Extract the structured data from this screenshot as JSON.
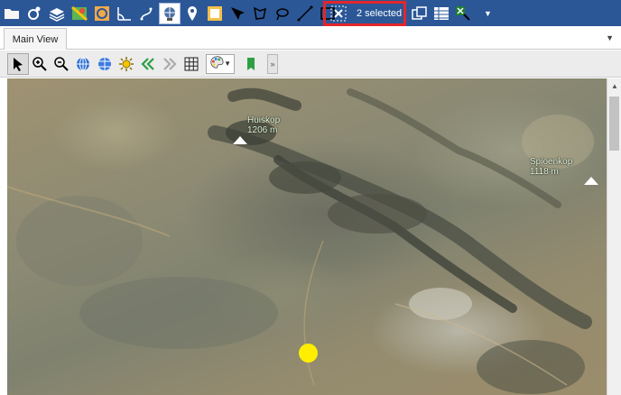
{
  "toolbar": {
    "selection_count_label": "2 selected",
    "icons": [
      "folder-icon",
      "settings-pin-icon",
      "layers-icon",
      "map-icon",
      "circle-frame-icon",
      "angle-measure-icon",
      "path-icon",
      "globe-icon",
      "location-pin-icon",
      "frame-icon",
      "select-point-icon",
      "select-polygon-icon",
      "select-lasso-icon",
      "select-line-icon",
      "select-rectangle-icon",
      "clear-selection-icon",
      "copy-icon",
      "table-icon",
      "excel-icon",
      "overflow-dropdown-icon"
    ],
    "accent_color": "#2b5797",
    "highlight_color": "#e3262b"
  },
  "tabs": {
    "main_view": "Main View"
  },
  "map_toolbar": {
    "icons": [
      "pointer-icon",
      "zoom-in-icon",
      "zoom-out-icon",
      "globe-blue-icon",
      "globe-grid-icon",
      "sun-settings-icon",
      "back-icon",
      "forward-icon",
      "grid-icon",
      "color-scheme-icon",
      "bookmark-icon",
      "more-icon"
    ]
  },
  "map": {
    "labels": {
      "huiskop": {
        "name": "Huiskop",
        "elevation": "1206 m"
      },
      "spioenkop": {
        "name": "Spioenkop",
        "elevation": "1118 m"
      }
    },
    "marker_color": "#ffee00"
  }
}
